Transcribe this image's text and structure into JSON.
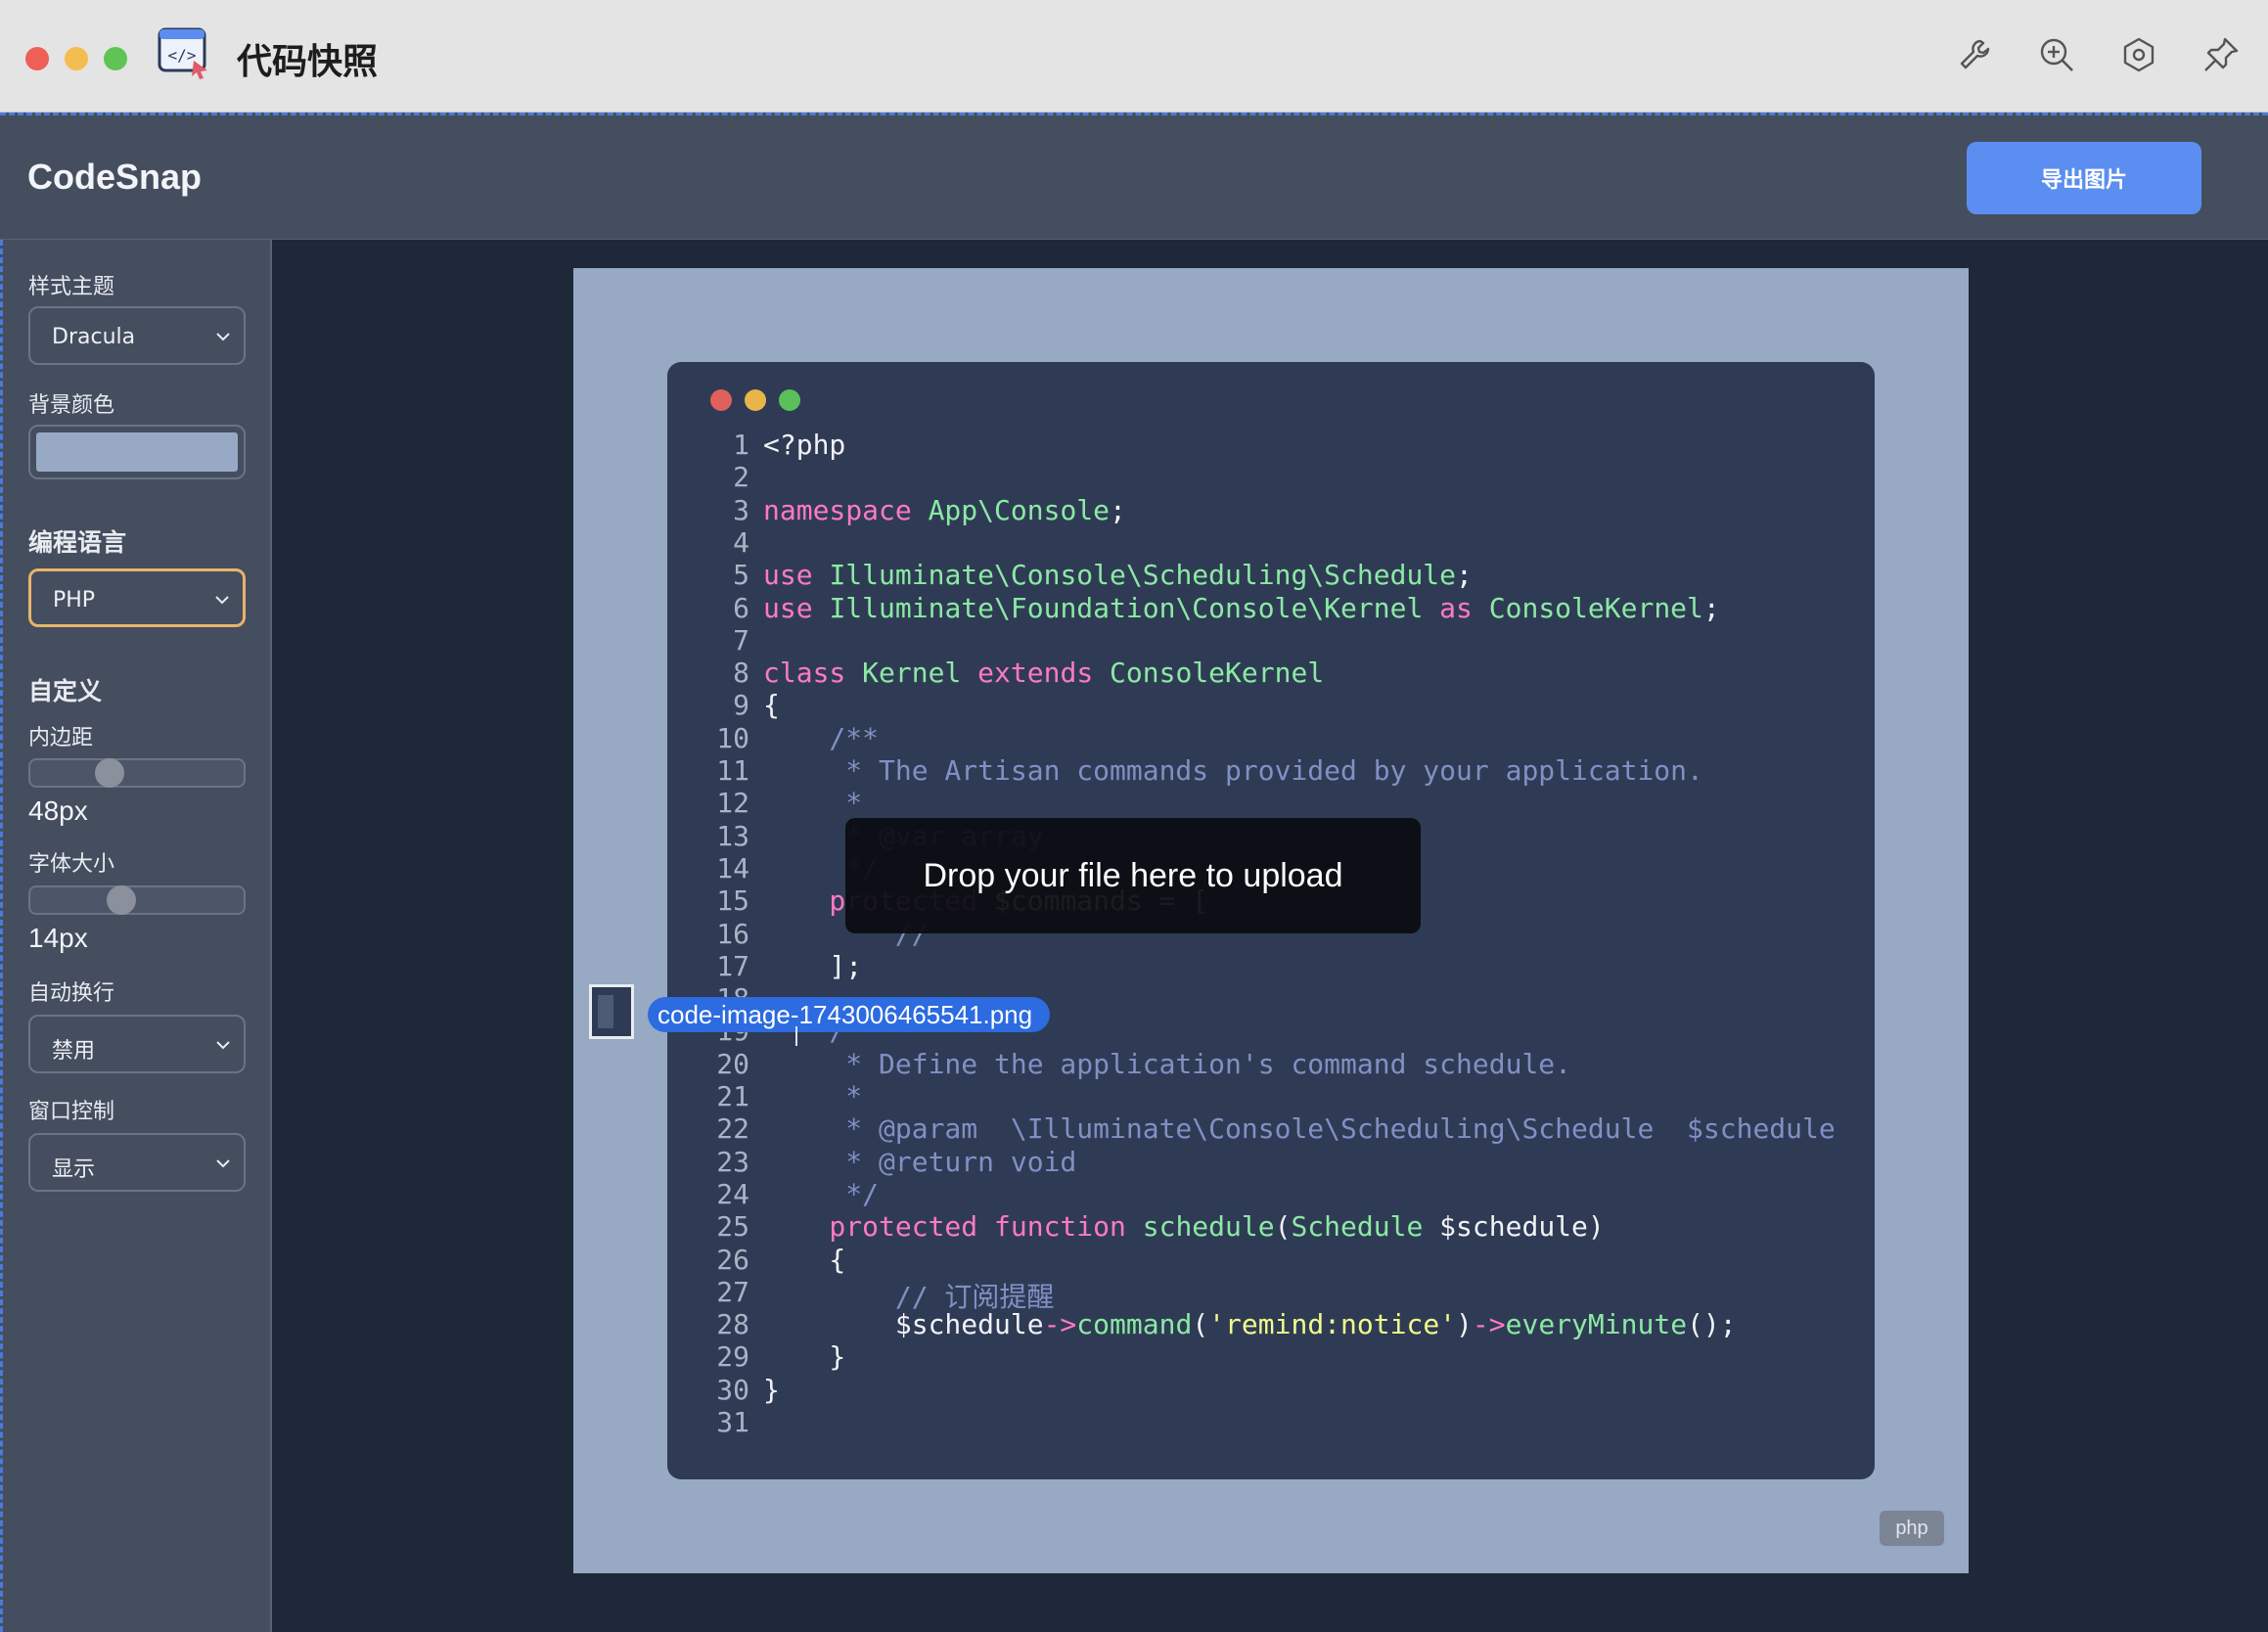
{
  "titlebar": {
    "title": "代码快照"
  },
  "header": {
    "brand": "CodeSnap",
    "export_label": "导出图片",
    "accent": "#5b8ef0"
  },
  "sidebar": {
    "theme_label": "样式主题",
    "theme_value": "Dracula",
    "bg_label": "背景颜色",
    "bg_color": "#97a9c4",
    "lang_label": "编程语言",
    "lang_value": "PHP",
    "custom_label": "自定义",
    "padding_label": "内边距",
    "padding_value": "48px",
    "font_label": "字体大小",
    "font_value": "14px",
    "wrap_label": "自动换行",
    "wrap_value": "禁用",
    "window_label": "窗口控制",
    "window_value": "显示"
  },
  "canvas": {
    "background": "#97a9c3",
    "lang_badge": "php"
  },
  "code": {
    "lines": [
      {
        "n": "1",
        "parts": [
          [
            "",
            "<?php"
          ]
        ]
      },
      {
        "n": "2",
        "parts": []
      },
      {
        "n": "3",
        "parts": [
          [
            "kw",
            "namespace "
          ],
          [
            "cls",
            "App\\Console"
          ],
          [
            "",
            ";"
          ]
        ]
      },
      {
        "n": "4",
        "parts": []
      },
      {
        "n": "5",
        "parts": [
          [
            "kw",
            "use "
          ],
          [
            "cls",
            "Illuminate\\Console\\Scheduling\\Schedule"
          ],
          [
            "",
            ";"
          ]
        ]
      },
      {
        "n": "6",
        "parts": [
          [
            "kw",
            "use "
          ],
          [
            "cls",
            "Illuminate\\Foundation\\Console\\Kernel"
          ],
          [
            "kw",
            " as "
          ],
          [
            "cls",
            "ConsoleKernel"
          ],
          [
            "",
            ";"
          ]
        ]
      },
      {
        "n": "7",
        "parts": []
      },
      {
        "n": "8",
        "parts": [
          [
            "kw",
            "class "
          ],
          [
            "cls",
            "Kernel "
          ],
          [
            "kw",
            "extends "
          ],
          [
            "cls",
            "ConsoleKernel"
          ]
        ]
      },
      {
        "n": "9",
        "parts": [
          [
            "",
            "{"
          ]
        ]
      },
      {
        "n": "10",
        "parts": [
          [
            "cm",
            "    /**"
          ]
        ]
      },
      {
        "n": "11",
        "parts": [
          [
            "cm",
            "     * The Artisan commands provided by your application."
          ]
        ]
      },
      {
        "n": "12",
        "parts": [
          [
            "cm",
            "     *"
          ]
        ]
      },
      {
        "n": "13",
        "parts": [
          [
            "cm",
            "     * @var array"
          ]
        ]
      },
      {
        "n": "14",
        "parts": [
          [
            "cm",
            "     */"
          ]
        ]
      },
      {
        "n": "15",
        "parts": [
          [
            "kw",
            "    protected "
          ],
          [
            "",
            "$commands = ["
          ]
        ]
      },
      {
        "n": "16",
        "parts": [
          [
            "cm",
            "        //"
          ]
        ]
      },
      {
        "n": "17",
        "parts": [
          [
            "",
            "    ];"
          ]
        ]
      },
      {
        "n": "18",
        "parts": []
      },
      {
        "n": "19",
        "parts": [
          [
            "cm",
            "    /**"
          ]
        ]
      },
      {
        "n": "20",
        "parts": [
          [
            "cm",
            "     * Define the application's command schedule."
          ]
        ]
      },
      {
        "n": "21",
        "parts": [
          [
            "cm",
            "     *"
          ]
        ]
      },
      {
        "n": "22",
        "parts": [
          [
            "cm",
            "     * @param  \\Illuminate\\Console\\Scheduling\\Schedule  $schedule"
          ]
        ]
      },
      {
        "n": "23",
        "parts": [
          [
            "cm",
            "     * @return void"
          ]
        ]
      },
      {
        "n": "24",
        "parts": [
          [
            "cm",
            "     */"
          ]
        ]
      },
      {
        "n": "25",
        "parts": [
          [
            "kw",
            "    protected function "
          ],
          [
            "cls",
            "schedule"
          ],
          [
            "",
            "("
          ],
          [
            "cls",
            "Schedule "
          ],
          [
            "",
            "$schedule)"
          ]
        ]
      },
      {
        "n": "26",
        "parts": [
          [
            "",
            "    {"
          ]
        ]
      },
      {
        "n": "27",
        "parts": [
          [
            "cm",
            "        // 订阅提醒"
          ]
        ]
      },
      {
        "n": "28",
        "parts": [
          [
            "",
            "        $schedule"
          ],
          [
            "op",
            "->"
          ],
          [
            "cls",
            "command"
          ],
          [
            "",
            "("
          ],
          [
            "str",
            "'remind:notice'"
          ],
          [
            "",
            ")"
          ],
          [
            "op",
            "->"
          ],
          [
            "cls",
            "everyMinute"
          ],
          [
            "",
            "();"
          ]
        ]
      },
      {
        "n": "29",
        "parts": [
          [
            "",
            "    }"
          ]
        ]
      },
      {
        "n": "30",
        "parts": [
          [
            "",
            "}"
          ]
        ]
      },
      {
        "n": "31",
        "parts": []
      }
    ]
  },
  "drop": {
    "message": "Drop your file here to upload",
    "filename": "code-image-1743006465541.png"
  }
}
